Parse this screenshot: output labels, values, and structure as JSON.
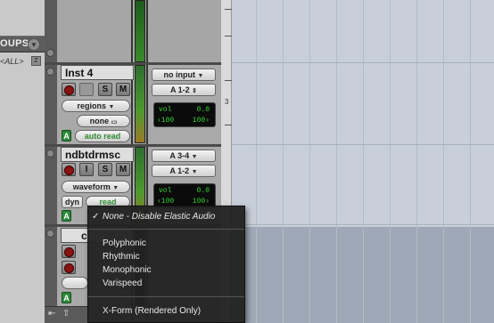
{
  "groups": {
    "title": "OUPS",
    "all_label": "<ALL>",
    "flag_glyph": "Z",
    "menu_icon": "chevron-down-icon"
  },
  "tracks": [
    {
      "name": "Inst 4",
      "input": "no input",
      "output": "A 1-2",
      "view": "regions",
      "none_label": "none",
      "automation": "auto read",
      "solo": "S",
      "mute": "M",
      "vol_label": "vol",
      "vol_value": "0.0",
      "pan_left": "‹100",
      "pan_right": "100›",
      "voice": "A",
      "ruler_number": "3"
    },
    {
      "name": "ndbtdrmsc",
      "input": "A 3-4",
      "output": "A 1-2",
      "view": "waveform",
      "dyn_label": "dyn",
      "automation": "read",
      "input_monitor": "I",
      "solo": "S",
      "mute": "M",
      "vol_label": "vol",
      "vol_value": "0.0",
      "pan_left": "‹100",
      "pan_right": "100›",
      "voice": "A"
    }
  ],
  "third_track": {
    "name_partial": "c",
    "voice": "A"
  },
  "elastic_menu": {
    "checked_item": "None - Disable Elastic Audio",
    "check_glyph": "✓",
    "items": [
      "Polyphonic",
      "Rhythmic",
      "Monophonic",
      "Varispeed"
    ],
    "rendered_item": "X-Form (Rendered Only)"
  },
  "bottom_bar": {
    "left_icon": "skip-to-start-icon",
    "up_icon": "upload-icon"
  },
  "colors": {
    "meter_green": "#3a8a2a",
    "lcd_text": "#35d635",
    "record_red": "#8b1212",
    "voice_green": "#2a8a3a"
  }
}
